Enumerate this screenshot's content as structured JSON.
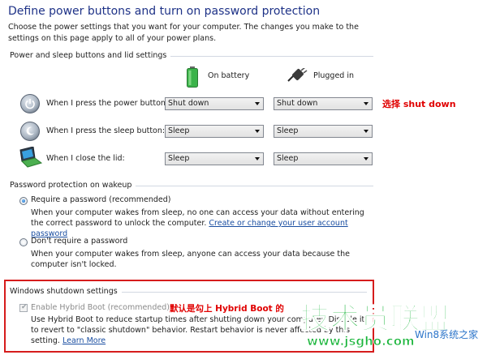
{
  "page": {
    "title": "Define power buttons and turn on password protection",
    "intro": "Choose the power settings that you want for your computer. The changes you make to the settings on this page apply to all of your power plans."
  },
  "buttons_section": {
    "header": "Power and sleep buttons and lid settings",
    "col_battery": "On battery",
    "col_plugged": "Plugged in",
    "rows": [
      {
        "label": "When I press the power button:",
        "battery": "Shut down",
        "plugged": "Shut down"
      },
      {
        "label": "When I press the sleep button:",
        "battery": "Sleep",
        "plugged": "Sleep"
      },
      {
        "label": "When I close the lid:",
        "battery": "Sleep",
        "plugged": "Sleep"
      }
    ]
  },
  "password_section": {
    "header": "Password protection on wakeup",
    "require_label": "Require a password (recommended)",
    "require_desc": "When your computer wakes from sleep, no one can access your data without entering the correct password to unlock the computer.",
    "require_link": "Create or change your user account password",
    "dont_label": "Don't require a password",
    "dont_desc": "When your computer wakes from sleep, anyone can access your data because the computer isn't locked."
  },
  "shutdown_section": {
    "header": "Windows shutdown settings",
    "hybrid_label": "Enable Hybrid Boot (recommended)",
    "hybrid_desc": "Use Hybrid Boot to reduce startup times after shutting down your computer. Disable it to revert to \"classic shutdown\" behavior. Restart behavior is never affected by this setting.",
    "hybrid_link": "Learn More"
  },
  "annotations": {
    "shutdown_note": "选择 shut down",
    "hybrid_note": "默认是勾上 Hybrid Boot 的"
  },
  "watermark": {
    "main": "技术员联盟",
    "url": "www.jsgho.com",
    "win": "Win8系统之家"
  },
  "colors": {
    "title": "#1e3287",
    "link": "#1a4ea1",
    "annotation": "#e00000",
    "watermark": "#19b53a"
  },
  "icons": [
    "battery-icon",
    "plug-icon",
    "power-button-icon",
    "sleep-button-icon",
    "laptop-lid-icon",
    "dropdown-arrow-icon"
  ]
}
